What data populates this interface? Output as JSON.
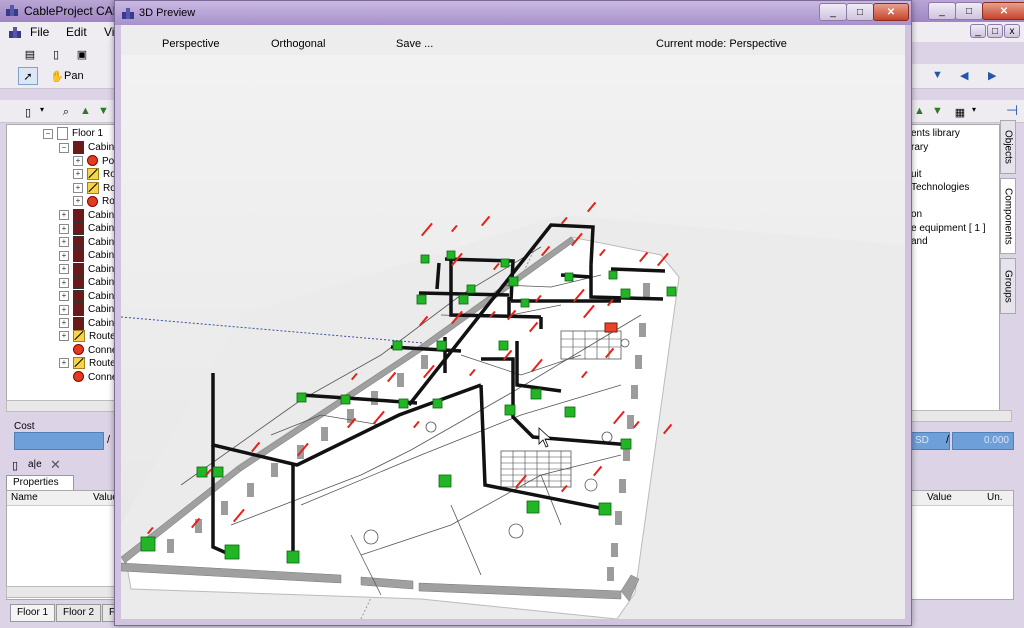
{
  "main": {
    "title": "CableProject CAD (v",
    "menu": [
      "File",
      "Edit",
      "Vi"
    ],
    "pan_label": "Pan",
    "tree": {
      "root_label": "Floor 1",
      "rows": [
        {
          "indent": 1,
          "kind": "cabinet",
          "label": "Cabine"
        },
        {
          "indent": 2,
          "kind": "connector",
          "label": "Po"
        },
        {
          "indent": 2,
          "kind": "route",
          "label": "Ro"
        },
        {
          "indent": 2,
          "kind": "route",
          "label": "Ro"
        },
        {
          "indent": 2,
          "kind": "connector",
          "label": "Ro"
        },
        {
          "indent": 1,
          "kind": "cabinet",
          "label": "Cabine"
        },
        {
          "indent": 1,
          "kind": "cabinet",
          "label": "Cabine"
        },
        {
          "indent": 1,
          "kind": "cabinet",
          "label": "Cabine"
        },
        {
          "indent": 1,
          "kind": "cabinet",
          "label": "Cabine"
        },
        {
          "indent": 1,
          "kind": "cabinet",
          "label": "Cabine"
        },
        {
          "indent": 1,
          "kind": "cabinet",
          "label": "Cabine"
        },
        {
          "indent": 1,
          "kind": "cabinet",
          "label": "Cabine"
        },
        {
          "indent": 1,
          "kind": "cabinet",
          "label": "Cabine"
        },
        {
          "indent": 1,
          "kind": "cabinet",
          "label": "Cabine"
        },
        {
          "indent": 1,
          "kind": "route",
          "label": "Route"
        },
        {
          "indent": 1,
          "kind": "connector",
          "label": "Conne"
        },
        {
          "indent": 1,
          "kind": "route",
          "label": "Route"
        },
        {
          "indent": 1,
          "kind": "connector",
          "label": "Conne"
        }
      ]
    },
    "cost_label": "Cost",
    "cost_sep": "/",
    "properties_tab": "Properties",
    "prop_columns": [
      "Name",
      "Value"
    ],
    "right_panel": {
      "lines": [
        "ents library",
        "rary",
        "",
        "uit",
        "Technologies",
        "",
        "on",
        "e equipment  [ 1 ]",
        "and"
      ],
      "side_tabs": [
        "Objects",
        "Components",
        "Groups"
      ],
      "cost_right": "SD",
      "cost_value": "0.000",
      "prop_columns": [
        "Value",
        "Un."
      ]
    },
    "floor_tabs": [
      "Floor 1",
      "Floor 2",
      "F"
    ],
    "abc_icon": "a|e"
  },
  "preview": {
    "title": "3D Preview",
    "toolbar": {
      "perspective": "Perspective",
      "orthogonal": "Orthogonal",
      "save": "Save ...",
      "mode": "Current mode: Perspective"
    },
    "colors": {
      "device": "#22b526",
      "cabinet_alert": "#e8442a",
      "route": "#111111",
      "label": "#e8201a",
      "floor": "#ffffff",
      "wall": "#9c9c9c"
    }
  }
}
